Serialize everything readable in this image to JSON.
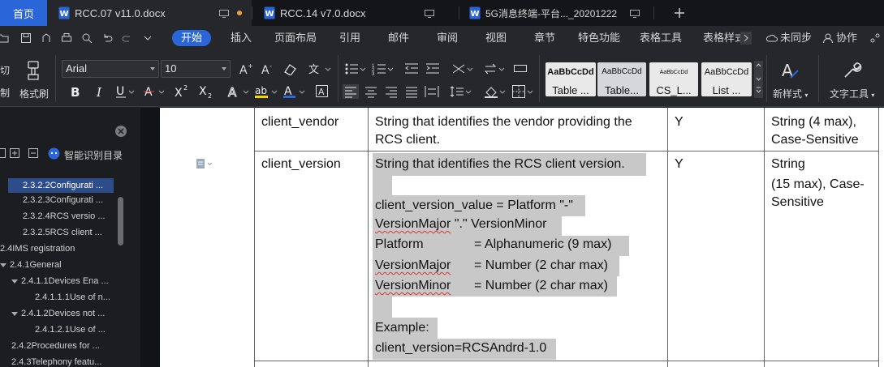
{
  "tabs": [
    {
      "label": "首页"
    },
    {
      "label": "RCC.07 v11.0.docx"
    },
    {
      "label": "RCC.14 v7.0.docx"
    },
    {
      "label": "5G消息终端-平台..._20201222"
    }
  ],
  "colors": {
    "accent": "#2b66d9",
    "unsaved_dot": "#e8a33a",
    "highlight": "#c8c8c8",
    "spell_error": "#dd3333"
  },
  "menu": {
    "items": [
      "开始",
      "插入",
      "页面布局",
      "引用",
      "邮件",
      "审阅",
      "视图",
      "章节",
      "特色功能",
      "表格工具",
      "表格样式"
    ],
    "sync": "未同步",
    "collab": "协作"
  },
  "ribbon": {
    "cut_label": "切",
    "copy_label": "制",
    "format_painter": "格式刷",
    "font_name": "Arial",
    "font_size": "10",
    "styles": [
      {
        "sample": "AaBbCcDd",
        "name": "Table ..."
      },
      {
        "sample": "AaBbCcDd",
        "name": "Table..."
      },
      {
        "sample": "AaBbCcDd",
        "name": "CS_L..."
      },
      {
        "sample": "AaBbCcDd",
        "name": "List ..."
      }
    ],
    "new_style": "新样式",
    "text_tools": "文字工具"
  },
  "nav": {
    "smart_toc": "智能识别目录",
    "items": [
      {
        "label": "2.3.2.2Configurati ...",
        "selected": true
      },
      {
        "label": "2.3.2.3Configurati ..."
      },
      {
        "label": "2.3.2.4RCS versio ..."
      },
      {
        "label": "2.3.2.5RCS client ..."
      },
      {
        "label": "2.4IMS registration"
      },
      {
        "label": "2.4.1General"
      },
      {
        "label": "2.4.1.1Devices Ena ..."
      },
      {
        "label": "2.4.1.1.1Use of n..."
      },
      {
        "label": "2.4.1.2Devices not ..."
      },
      {
        "label": "2.4.1.2.1Use of ..."
      },
      {
        "label": "2.4.2Procedures for ..."
      },
      {
        "label": "2.4.3Telephony featu..."
      }
    ]
  },
  "document": {
    "row1": {
      "param": "client_vendor",
      "desc": [
        "String that identifies the vendor providing the",
        "RCS client."
      ],
      "mandatory": "Y",
      "type": [
        "String (4 max),",
        "Case-Sensitive"
      ]
    },
    "row2": {
      "param": "client_version",
      "desc_first": "String that identifies the RCS client version.",
      "formula": [
        "client_version_value = Platform \"-\"",
        "VersionMajor \".\" VersionMinor"
      ],
      "defs": [
        {
          "name": "Platform",
          "value": "= Alphanumeric (9 max)"
        },
        {
          "name": "VersionMajor",
          "value": "= Number (2 char max)"
        },
        {
          "name": "VersionMinor",
          "value": "= Number (2 char max)"
        }
      ],
      "example_label": "Example:",
      "example": "client_version=RCSAndrd-1.0",
      "mandatory": "Y",
      "type": [
        "String",
        "(15 max), Case-",
        "Sensitive"
      ]
    }
  }
}
